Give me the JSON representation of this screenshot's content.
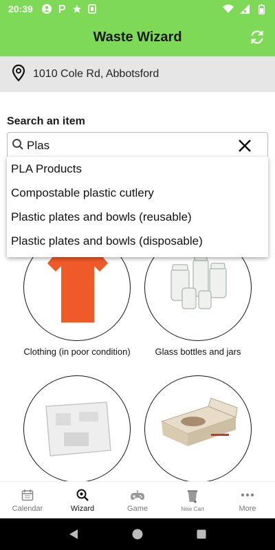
{
  "status": {
    "time": "20:39"
  },
  "app": {
    "title": "Waste Wizard"
  },
  "address": {
    "text": "1010 Cole Rd, Abbotsford"
  },
  "search": {
    "label": "Search an item",
    "value": "Plas",
    "suggestions": [
      "PLA Products",
      "Compostable plastic cutlery",
      "Plastic plates and bowls (reusable)",
      "Plastic plates and bowls (disposable)"
    ]
  },
  "items": [
    {
      "label": "Clothing (in poor condition)"
    },
    {
      "label": "Glass bottles and jars"
    },
    {
      "label": ""
    },
    {
      "label": ""
    }
  ],
  "tabs": [
    {
      "label": "Calendar",
      "icon": "calendar-icon"
    },
    {
      "label": "Wizard",
      "icon": "wizard-icon"
    },
    {
      "label": "Game",
      "icon": "gamepad-icon"
    },
    {
      "label": "New Cart",
      "icon": "cart-icon"
    },
    {
      "label": "More",
      "icon": "more-icon"
    }
  ],
  "colors": {
    "accent": "#7ed957",
    "address_bg": "#e6e6e6"
  }
}
